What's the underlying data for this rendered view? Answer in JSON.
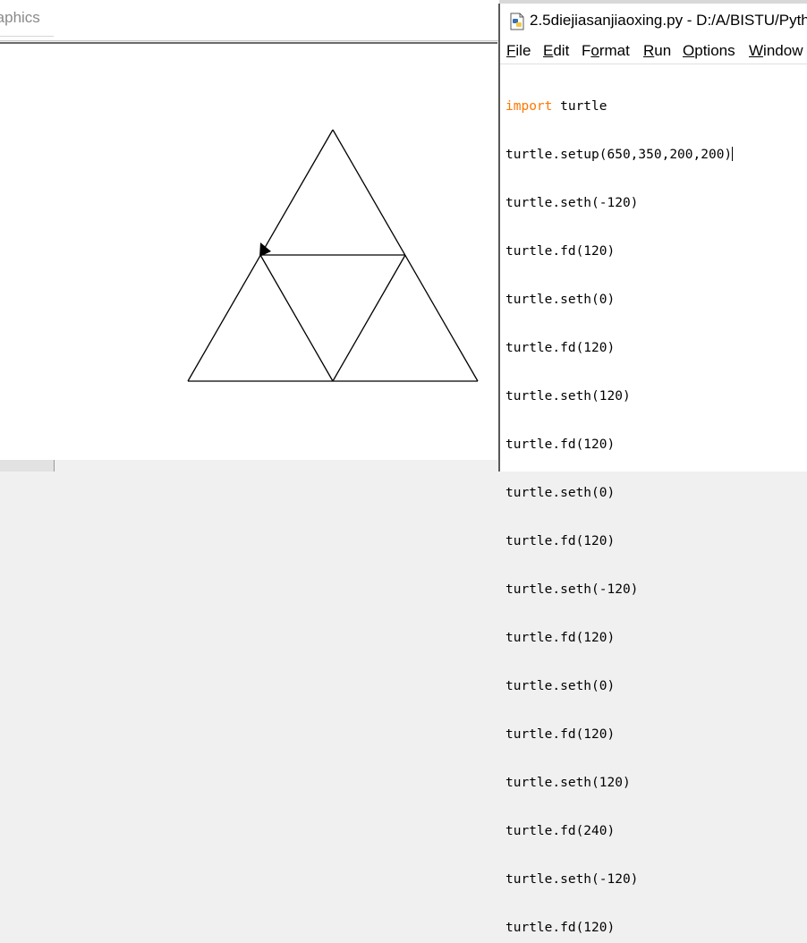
{
  "turtle_window": {
    "title": "Graphics",
    "title_visible": "raphics"
  },
  "editor": {
    "title": "2.5diejiasanjiaoxing.py - D:/A/BISTU/Pyth",
    "menu": [
      {
        "label": "File",
        "underline": "F",
        "rest": "ile"
      },
      {
        "label": "Edit",
        "underline": "E",
        "rest": "dit"
      },
      {
        "label": "Format",
        "pre": "F",
        "underline": "o",
        "rest": "rmat"
      },
      {
        "label": "Run",
        "underline": "R",
        "rest": "un"
      },
      {
        "label": "Options",
        "underline": "O",
        "rest": "ptions"
      },
      {
        "label": "Window",
        "underline": "W",
        "rest": "indow"
      }
    ],
    "code_lines": [
      {
        "keyword": "import",
        "text": " turtle"
      },
      {
        "keyword": "",
        "text": "turtle.setup(650,350,200,200)"
      },
      {
        "keyword": "",
        "text": "turtle.seth(-120)"
      },
      {
        "keyword": "",
        "text": "turtle.fd(120)"
      },
      {
        "keyword": "",
        "text": "turtle.seth(0)"
      },
      {
        "keyword": "",
        "text": "turtle.fd(120)"
      },
      {
        "keyword": "",
        "text": "turtle.seth(120)"
      },
      {
        "keyword": "",
        "text": "turtle.fd(120)"
      },
      {
        "keyword": "",
        "text": "turtle.seth(0)"
      },
      {
        "keyword": "",
        "text": "turtle.fd(120)"
      },
      {
        "keyword": "",
        "text": "turtle.seth(-120)"
      },
      {
        "keyword": "",
        "text": "turtle.fd(120)"
      },
      {
        "keyword": "",
        "text": "turtle.seth(0)"
      },
      {
        "keyword": "",
        "text": "turtle.fd(120)"
      },
      {
        "keyword": "",
        "text": "turtle.seth(120)"
      },
      {
        "keyword": "",
        "text": "turtle.fd(240)"
      },
      {
        "keyword": "",
        "text": "turtle.seth(-120)"
      },
      {
        "keyword": "",
        "text": "turtle.fd(120)"
      }
    ],
    "keyword_color": "#ff7700",
    "file_icon": "python-file-icon"
  },
  "drawing": {
    "description_free": true,
    "turtle_heading_deg": -120,
    "shape_icon": "turtle-arrow-icon"
  }
}
